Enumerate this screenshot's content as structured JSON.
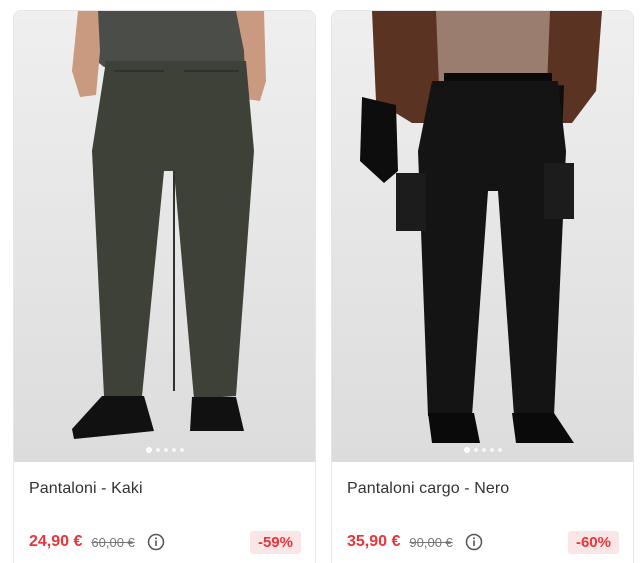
{
  "products": [
    {
      "name": "Pantaloni - Kaki",
      "price": "24,90 €",
      "old_price": "60,00 €",
      "discount": "-59%",
      "image_color": "#3d4137",
      "carousel": {
        "count": 5,
        "active": 1
      }
    },
    {
      "name": "Pantaloni cargo - Nero",
      "price": "35,90 €",
      "old_price": "90,00 €",
      "discount": "-60%",
      "image_color": "#141414",
      "carousel": {
        "count": 5,
        "active": 1
      }
    }
  ],
  "colors": {
    "price": "#e8343a",
    "badge_bg": "#fbe6e7"
  },
  "icons": {
    "info": "info-circle-icon"
  }
}
